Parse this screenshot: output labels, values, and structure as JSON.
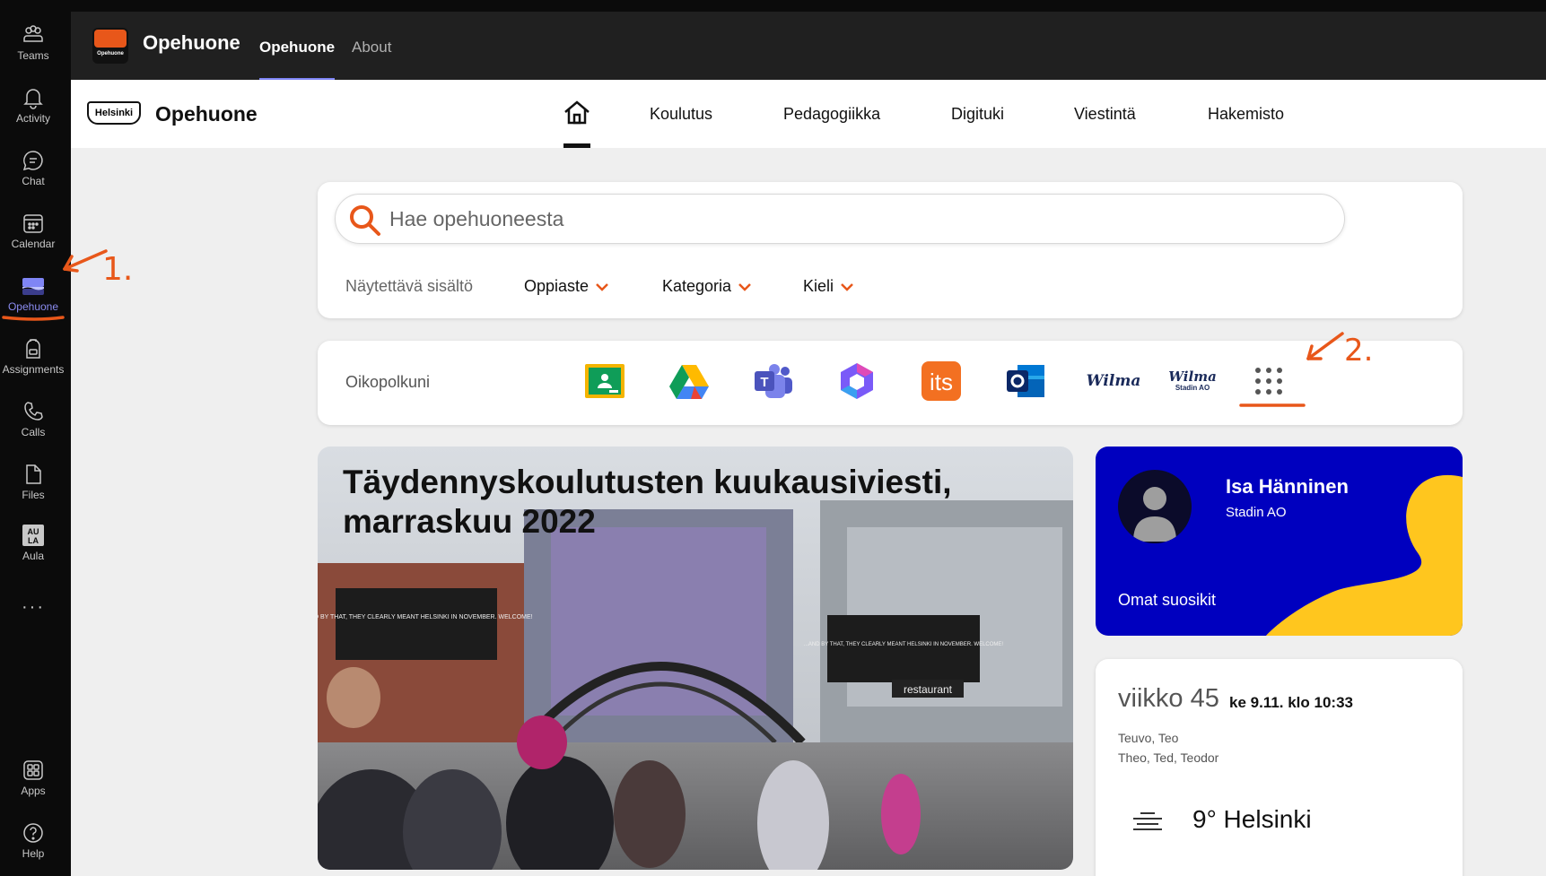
{
  "teams_rail": [
    {
      "label": "Teams",
      "icon": "teams-icon"
    },
    {
      "label": "Activity",
      "icon": "bell-icon"
    },
    {
      "label": "Chat",
      "icon": "chat-icon"
    },
    {
      "label": "Calendar",
      "icon": "calendar-icon"
    },
    {
      "label": "Opehuone",
      "icon": "opehuone-app-icon",
      "active": true
    },
    {
      "label": "Assignments",
      "icon": "backpack-icon"
    },
    {
      "label": "Calls",
      "icon": "phone-icon"
    },
    {
      "label": "Files",
      "icon": "file-icon"
    },
    {
      "label": "Aula",
      "icon": "aula-icon"
    },
    {
      "label": "Apps",
      "icon": "apps-icon"
    },
    {
      "label": "Help",
      "icon": "help-icon"
    }
  ],
  "app_header": {
    "logo_text": "Opehuone",
    "title": "Opehuone",
    "tabs": [
      "Opehuone",
      "About"
    ]
  },
  "site_nav": {
    "logo_text": "Helsinki",
    "title": "Opehuone",
    "links": [
      "Koulutus",
      "Pedagogiikka",
      "Digituki",
      "Viestintä",
      "Hakemisto"
    ]
  },
  "search": {
    "placeholder": "Hae opehuoneesta",
    "content_label": "Näytettävä sisältö",
    "filters": [
      "Oppiaste",
      "Kategoria",
      "Kieli"
    ]
  },
  "shortcuts": {
    "label": "Oikopolkuni",
    "items": [
      "google-classroom-icon",
      "google-drive-icon",
      "microsoft-teams-icon",
      "microsoft-365-icon",
      "its-icon",
      "outlook-icon",
      "wilma-icon",
      "wilma-stadin-ao-icon",
      "more-apps-icon"
    ],
    "its_text": "its",
    "wilma_text": "Wilma",
    "wilma_sub": "Stadin AO"
  },
  "hero": {
    "title": "Täydennyskoulutusten kuukausiviesti, marraskuu 2022",
    "screen_text": "...AND BY THAT, THEY CLEARLY MEANT HELSINKI IN NOVEMBER. WELCOME!",
    "shop_sign": "restaurant"
  },
  "profile": {
    "name": "Isa Hänninen",
    "org": "Stadin AO",
    "favorites": "Omat suosikit"
  },
  "week": {
    "week": "viikko 45",
    "date": "ke 9.11.  klo 10:33",
    "names1": "Teuvo, Teo",
    "names2": "Theo, Ted, Teodor",
    "weather": "9° Helsinki"
  },
  "annotations": {
    "step1": "1.",
    "step2": "2."
  },
  "colors": {
    "accent_orange": "#e8571a",
    "profile_blue": "#0000bf",
    "profile_yellow": "#ffc61e",
    "teams_purple": "#7f85f5"
  }
}
